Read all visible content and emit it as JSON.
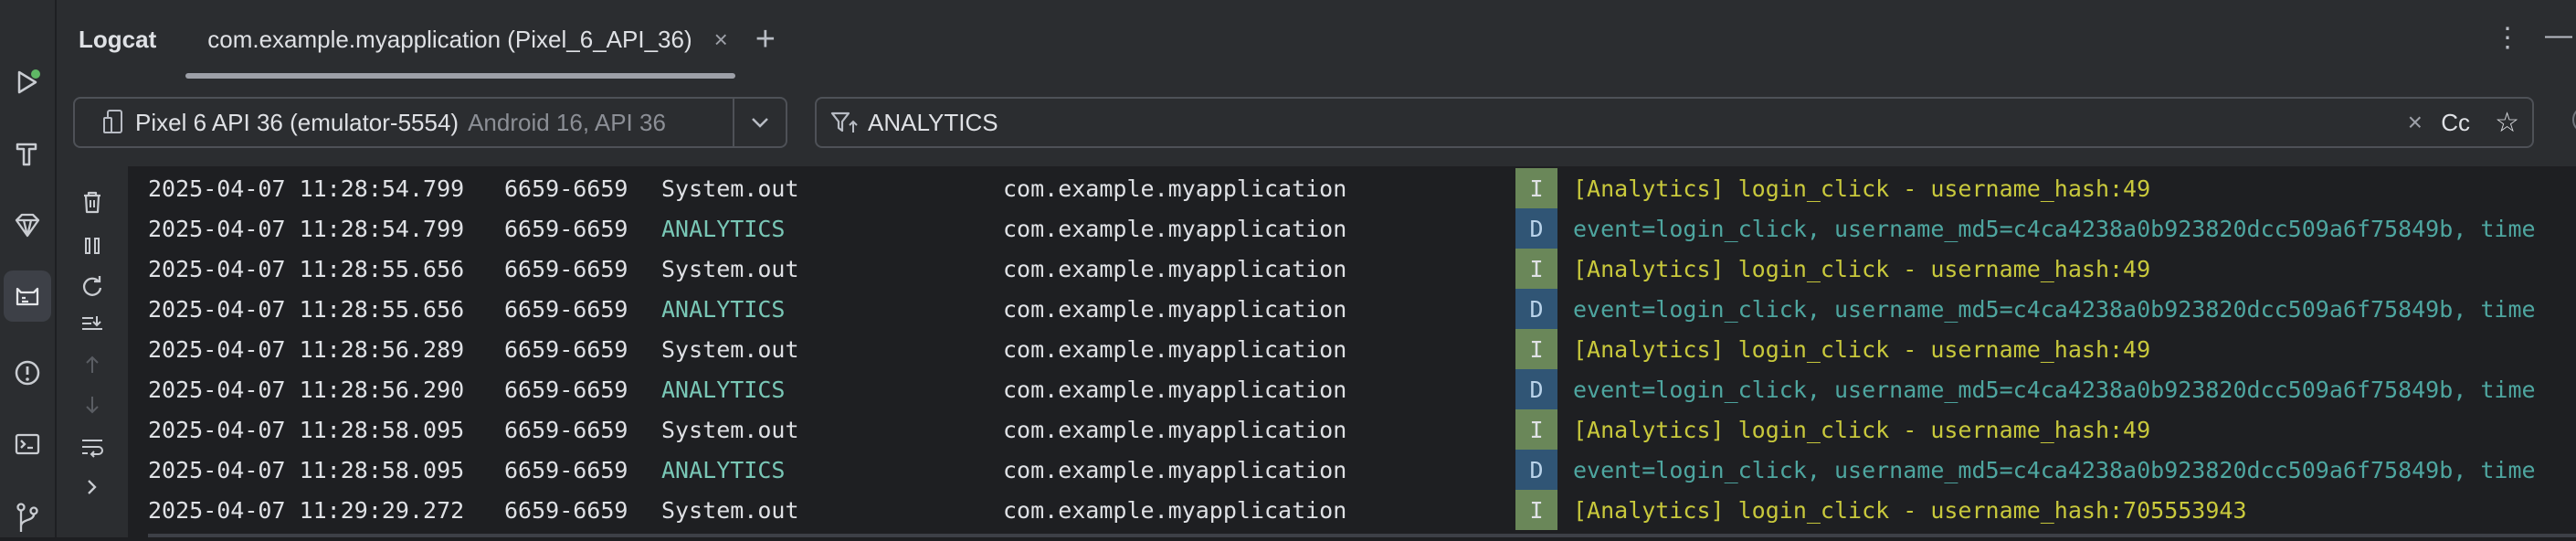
{
  "header": {
    "tool_window_title": "Logcat",
    "tab_title": "com.example.myapplication (Pixel_6_API_36)",
    "tab_close": "×",
    "add_tab": "+",
    "more": "⋮",
    "minimize": "—"
  },
  "toolbar": {
    "device_name": "Pixel 6 API 36 (emulator-5554)",
    "device_api": "Android 16, API 36",
    "filter_value": "ANALYTICS",
    "clear": "×",
    "match_case": "Cc",
    "favorite": "☆",
    "help": "?"
  },
  "colors": {
    "level_info_bg": "#6a8759",
    "level_debug_bg": "#305575",
    "tag_analytics": "#79c7b6",
    "message_info": "#c9c93c",
    "message_debug": "#4ea6a0"
  },
  "logs": [
    {
      "ts": "2025-04-07 11:28:54.799",
      "pid": "6659-6659",
      "tag": "System.out",
      "pkg": "com.example.myapplication",
      "level": "I",
      "msg": "[Analytics] login_click - username_hash:49"
    },
    {
      "ts": "2025-04-07 11:28:54.799",
      "pid": "6659-6659",
      "tag": "ANALYTICS",
      "pkg": "com.example.myapplication",
      "level": "D",
      "msg": "event=login_click, username_md5=c4ca4238a0b923820dcc509a6f75849b, time"
    },
    {
      "ts": "2025-04-07 11:28:55.656",
      "pid": "6659-6659",
      "tag": "System.out",
      "pkg": "com.example.myapplication",
      "level": "I",
      "msg": "[Analytics] login_click - username_hash:49"
    },
    {
      "ts": "2025-04-07 11:28:55.656",
      "pid": "6659-6659",
      "tag": "ANALYTICS",
      "pkg": "com.example.myapplication",
      "level": "D",
      "msg": "event=login_click, username_md5=c4ca4238a0b923820dcc509a6f75849b, time"
    },
    {
      "ts": "2025-04-07 11:28:56.289",
      "pid": "6659-6659",
      "tag": "System.out",
      "pkg": "com.example.myapplication",
      "level": "I",
      "msg": "[Analytics] login_click - username_hash:49"
    },
    {
      "ts": "2025-04-07 11:28:56.290",
      "pid": "6659-6659",
      "tag": "ANALYTICS",
      "pkg": "com.example.myapplication",
      "level": "D",
      "msg": "event=login_click, username_md5=c4ca4238a0b923820dcc509a6f75849b, time"
    },
    {
      "ts": "2025-04-07 11:28:58.095",
      "pid": "6659-6659",
      "tag": "System.out",
      "pkg": "com.example.myapplication",
      "level": "I",
      "msg": "[Analytics] login_click - username_hash:49"
    },
    {
      "ts": "2025-04-07 11:28:58.095",
      "pid": "6659-6659",
      "tag": "ANALYTICS",
      "pkg": "com.example.myapplication",
      "level": "D",
      "msg": "event=login_click, username_md5=c4ca4238a0b923820dcc509a6f75849b, time"
    },
    {
      "ts": "2025-04-07 11:29:29.272",
      "pid": "6659-6659",
      "tag": "System.out",
      "pkg": "com.example.myapplication",
      "level": "I",
      "msg": "[Analytics] login_click - username_hash:705553943"
    }
  ]
}
